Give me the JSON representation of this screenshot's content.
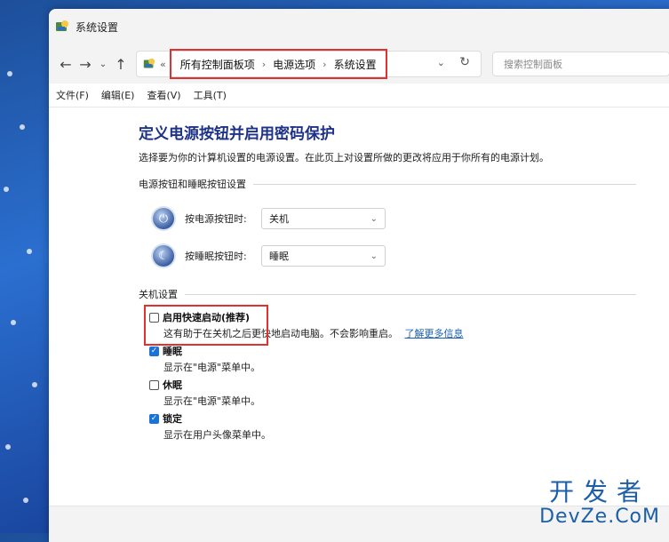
{
  "window": {
    "title": "系统设置"
  },
  "navigation": {
    "back_icon": "←",
    "forward_icon": "→",
    "recent_icon": "⌄",
    "up_icon": "↑",
    "breadcrumbs": [
      "所有控制面板项",
      "电源选项",
      "系统设置"
    ],
    "breadcrumb_overflow": "«",
    "breadcrumb_separator": "›",
    "dropdown_icon": "⌄",
    "refresh_icon": "↻",
    "search_placeholder": "搜索控制面板"
  },
  "menu": {
    "items": [
      "文件(F)",
      "编辑(E)",
      "查看(V)",
      "工具(T)"
    ]
  },
  "main": {
    "title": "定义电源按钮并启用密码保护",
    "description": "选择要为你的计算机设置的电源设置。在此页上对设置所做的更改将应用于你所有的电源计划。",
    "power_group": {
      "header": "电源按钮和睡眠按钮设置",
      "rows": [
        {
          "label": "按电源按钮时:",
          "value": "关机",
          "icon": "power-icon"
        },
        {
          "label": "按睡眠按钮时:",
          "value": "睡眠",
          "icon": "sleep-icon"
        }
      ]
    },
    "shutdown_group": {
      "header": "关机设置",
      "items": [
        {
          "label": "启用快速启动(推荐)",
          "checked": false,
          "description": "这有助于在关机之后更快地启动电脑。不会影响重启。",
          "link": "了解更多信息"
        },
        {
          "label": "睡眠",
          "checked": true,
          "description": "显示在\"电源\"菜单中。"
        },
        {
          "label": "休眠",
          "checked": false,
          "description": "显示在\"电源\"菜单中。"
        },
        {
          "label": "锁定",
          "checked": true,
          "description": "显示在用户头像菜单中。"
        }
      ]
    }
  },
  "watermark": {
    "cn": "开发者",
    "en": "DevZe.CoM"
  },
  "colors": {
    "accent": "#1a73d9",
    "title_blue": "#1e3287",
    "highlight_red": "#e03131",
    "link_blue": "#1a5fb4"
  }
}
